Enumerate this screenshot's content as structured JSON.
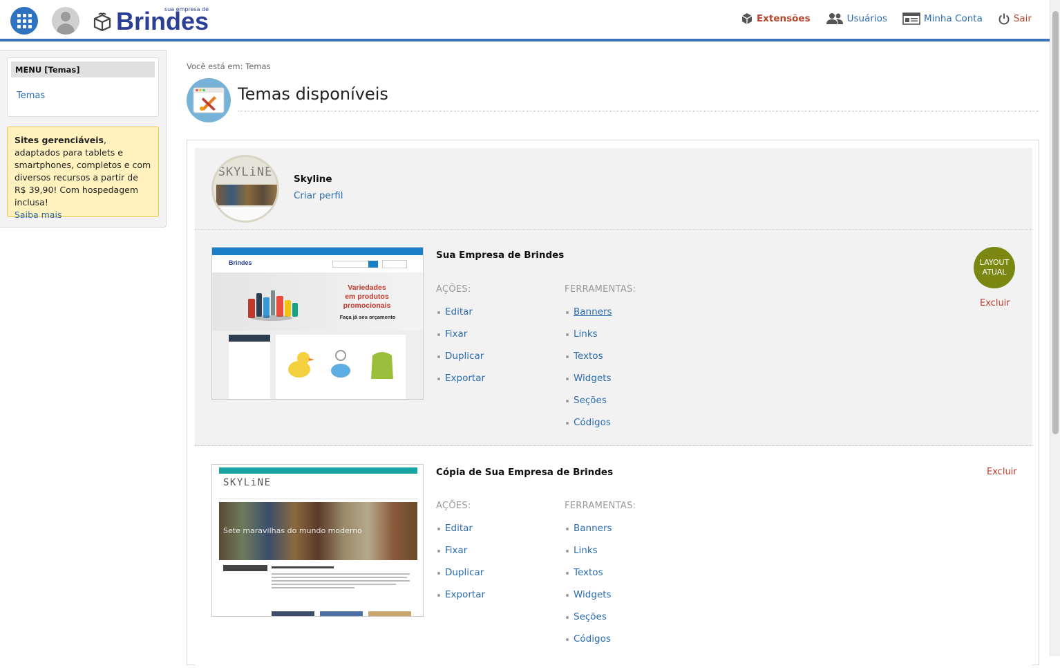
{
  "header": {
    "logo_sub": "sua empresa de",
    "logo_main": "Brindes",
    "nav": {
      "extensions": "Extensões",
      "users": "Usuários",
      "account": "Minha Conta",
      "exit": "Sair"
    }
  },
  "sidebar": {
    "menu_title": "MENU [Temas]",
    "menu_items": [
      "Temas"
    ],
    "promo": {
      "bold": "Sites gerenciáveis",
      "text": ", adaptados para tablets e smartphones, completos e com diversos recursos a partir de R$ 39,90! Com hospedagem inclusa!",
      "link": "Saiba mais"
    }
  },
  "main": {
    "breadcrumb": "Você está em: Temas",
    "title": "Temas disponíveis",
    "profile": {
      "thumb_text": "SKYLiNE",
      "name": "Skyline",
      "link": "Criar perfil"
    },
    "themes": [
      {
        "name": "Sua Empresa de Brindes",
        "actions_label": "AÇÕES:",
        "tools_label": "FERRAMENTAS:",
        "actions": [
          "Editar",
          "Fixar",
          "Duplicar",
          "Exportar"
        ],
        "tools": [
          "Banners",
          "Links",
          "Textos",
          "Widgets",
          "Seções",
          "Códigos"
        ],
        "badge": "LAYOUT ATUAL",
        "delete": "Excluir",
        "thumb": {
          "logo": "Brindes",
          "banner_line1": "Variedades",
          "banner_line2": "em produtos",
          "banner_line3": "promocionais",
          "banner_sub": "Faça já seu orçamento"
        }
      },
      {
        "name": "Cópia de Sua Empresa de Brindes",
        "actions_label": "AÇÕES:",
        "tools_label": "FERRAMENTAS:",
        "actions": [
          "Editar",
          "Fixar",
          "Duplicar",
          "Exportar"
        ],
        "tools": [
          "Banners",
          "Links",
          "Textos",
          "Widgets",
          "Seções",
          "Códigos"
        ],
        "delete": "Excluir",
        "thumb": {
          "logo": "SKYLiNE",
          "hero_text": "Sete maravilhas do mundo moderno"
        }
      }
    ]
  },
  "colors": {
    "brand_blue": "#2a3f95",
    "link_blue": "#2b6cb0",
    "accent_red": "#b7442b",
    "badge_green": "#7a8711"
  }
}
